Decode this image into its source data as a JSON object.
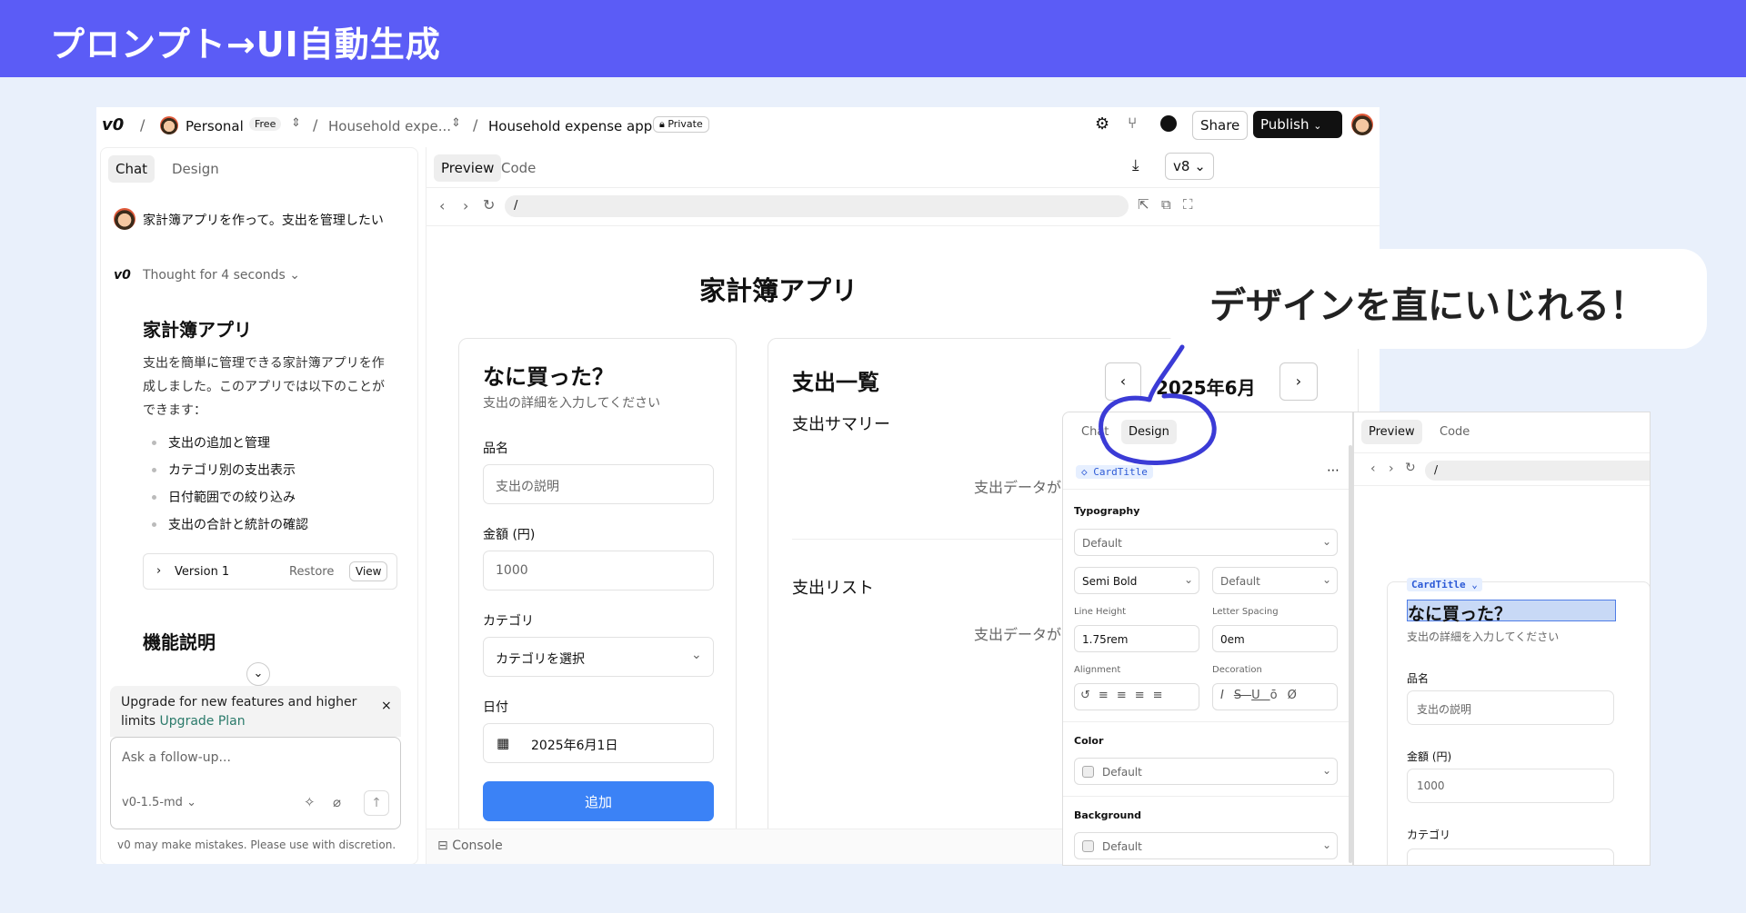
{
  "banner": {
    "title": "プロンプト→UI自動生成"
  },
  "topbar": {
    "logo": "v0",
    "workspace": "Personal",
    "plan_badge": "Free",
    "project_short": "Household expe...",
    "project": "Household expense app",
    "private_badge": "Private",
    "share": "Share",
    "publish": "Publish"
  },
  "chat": {
    "tabs": [
      "Chat",
      "Design"
    ],
    "user_message": "家計簿アプリを作って。支出を管理したい",
    "thought": "Thought for 4 seconds",
    "heading": "家計簿アプリ",
    "body": "支出を簡単に管理できる家計簿アプリを作成しました。このアプリでは以下のことができます：",
    "bullets": [
      "支出の追加と管理",
      "カテゴリ別の支出表示",
      "日付範囲での絞り込み",
      "支出の合計と統計の確認"
    ],
    "version": {
      "label": "Version 1",
      "restore": "Restore",
      "view": "View"
    },
    "heading2": "機能説明",
    "upgrade": {
      "text": "Upgrade for new features and higher limits ",
      "link": "Upgrade Plan"
    },
    "input_placeholder": "Ask a follow-up...",
    "model": "v0-1.5-md",
    "disclaimer": "v0 may make mistakes. Please use with discretion."
  },
  "preview": {
    "tabs": [
      "Preview",
      "Code"
    ],
    "version": "v8",
    "url": "/",
    "app_title": "家計簿アプリ",
    "form": {
      "title": "なに買った？",
      "subtitle": "支出の詳細を入力してください",
      "name_label": "品名",
      "name_placeholder": "支出の説明",
      "amount_label": "金額 (円)",
      "amount_value": "1000",
      "category_label": "カテゴリ",
      "category_placeholder": "カテゴリを選択",
      "date_label": "日付",
      "date_value": "2025年6月1日",
      "submit": "追加"
    },
    "list": {
      "title": "支出一覧",
      "month": "2025年6月",
      "summary_title": "支出サマリー",
      "summary_empty": "支出データが",
      "list_title": "支出リスト",
      "list_empty": "支出データが"
    },
    "console": "Console"
  },
  "callout": {
    "text": "デザインを直にいじれる！"
  },
  "design_panel": {
    "tabs": [
      "Chat",
      "Design"
    ],
    "component": "CardTitle",
    "typography_label": "Typography",
    "font_value": "Default",
    "weight_value": "Semi Bold",
    "size_value": "Default",
    "line_height_label": "Line Height",
    "line_height_value": "1.75rem",
    "letter_spacing_label": "Letter Spacing",
    "letter_spacing_value": "0em",
    "alignment_label": "Alignment",
    "decoration_label": "Decoration",
    "color_label": "Color",
    "color_value": "Default",
    "background_label": "Background",
    "background_value": "Default"
  },
  "mini_preview": {
    "tabs": [
      "Preview",
      "Code"
    ],
    "url": "/",
    "tag": "CardTitle",
    "title": "なに買った？",
    "subtitle": "支出の詳細を入力してください",
    "name_label": "品名",
    "name_placeholder": "支出の説明",
    "amount_label": "金額 (円)",
    "amount_value": "1000",
    "category_label": "カテゴリ"
  },
  "colors": {
    "banner": "#5b5cf6",
    "accent_blue": "#3b82f6",
    "annotation": "#3b3bd6"
  }
}
